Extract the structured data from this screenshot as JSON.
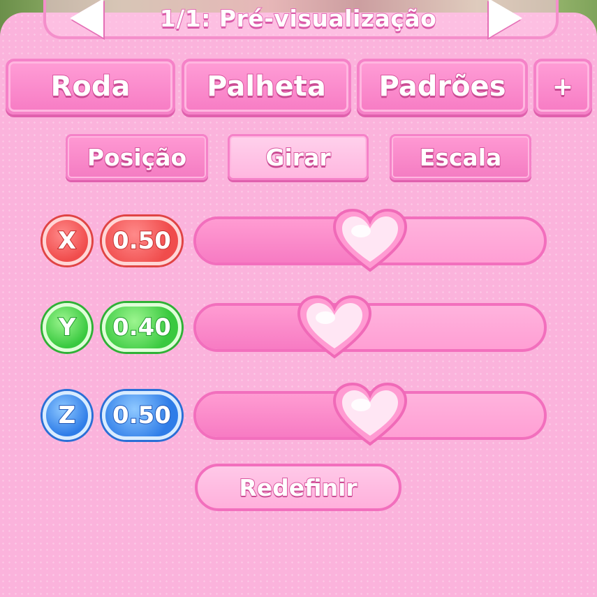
{
  "header": {
    "title": "1/1: Pré-visualização"
  },
  "tabs": [
    {
      "label": "Roda"
    },
    {
      "label": "Palheta"
    },
    {
      "label": "Padrões"
    },
    {
      "label": "+"
    }
  ],
  "subtabs": [
    {
      "label": "Posição"
    },
    {
      "label": "Girar"
    },
    {
      "label": "Escala"
    }
  ],
  "sliders": [
    {
      "axis": "X",
      "value": "0.50",
      "level": 0.5,
      "color": "#f04c4c"
    },
    {
      "axis": "Y",
      "value": "0.40",
      "level": 0.4,
      "color": "#39c93f"
    },
    {
      "axis": "Z",
      "value": "0.50",
      "level": 0.5,
      "color": "#2f7de8"
    }
  ],
  "reset_label": "Redefinir",
  "colors": {
    "panel": "#fbb3dc",
    "accent": "#f26fbd"
  },
  "icons": {
    "prev": "arrow-left-icon",
    "next": "arrow-right-icon",
    "knob": "heart-icon"
  }
}
